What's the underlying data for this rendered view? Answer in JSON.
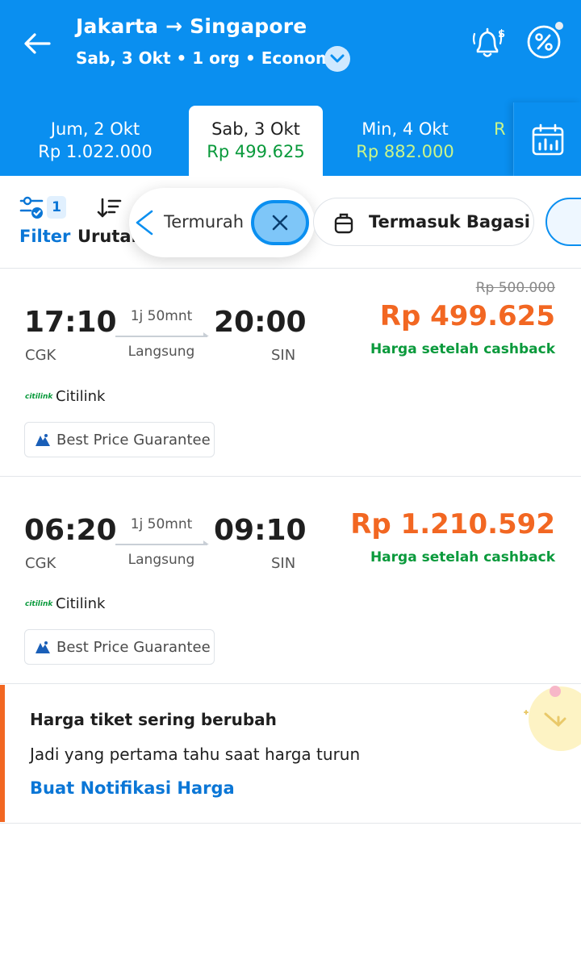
{
  "header": {
    "title": "Jakarta → Singapore",
    "subtitle": "Sab, 3 Okt • 1 org • Economy"
  },
  "date_tabs": [
    {
      "label": "Jum, 2 Okt",
      "price": "Rp 1.022.000",
      "selected": false
    },
    {
      "label": "Sab, 3 Okt",
      "price": "Rp 499.625",
      "selected": true
    },
    {
      "label": "Min, 4 Okt",
      "price": "Rp 882.000",
      "selected": false
    },
    {
      "label": "",
      "price": "R",
      "selected": false
    }
  ],
  "filterbar": {
    "filter_label": "Filter",
    "filter_count": "1",
    "sort_label": "Urutan",
    "sort_chip_label": "Termurah",
    "bagasi_chip_label": "Termasuk Bagasi"
  },
  "flights": [
    {
      "dep_time": "17:10",
      "dep_code": "CGK",
      "arr_time": "20:00",
      "arr_code": "SIN",
      "duration": "1j 50mnt",
      "stops": "Langsung",
      "old_price": "Rp 500.000",
      "price": "Rp 499.625",
      "cashback": "Harga setelah cashback",
      "airline_logo": "citilink",
      "airline": "Citilink",
      "badge": "Best Price Guarantee"
    },
    {
      "dep_time": "06:20",
      "dep_code": "CGK",
      "arr_time": "09:10",
      "arr_code": "SIN",
      "duration": "1j 50mnt",
      "stops": "Langsung",
      "old_price": "",
      "price": "Rp 1.210.592",
      "cashback": "Harga setelah cashback",
      "airline_logo": "citilink",
      "airline": "Citilink",
      "badge": "Best Price Guarantee"
    }
  ],
  "price_alert": {
    "title": "Harga tiket sering berubah",
    "description": "Jadi yang pertama tahu saat harga turun",
    "link": "Buat Notifikasi Harga"
  },
  "colors": {
    "brand_blue": "#0a8ff0",
    "price_orange": "#f26722",
    "cashback_green": "#0a9a3c",
    "link_blue": "#0a76d6"
  },
  "icons": [
    "back-arrow-icon",
    "chevron-down-icon",
    "price-alert-bell-icon",
    "promo-percent-icon",
    "calendar-chart-icon",
    "filter-sliders-icon",
    "sort-icon",
    "chevron-left-icon",
    "close-icon",
    "luggage-icon",
    "best-price-icon"
  ]
}
